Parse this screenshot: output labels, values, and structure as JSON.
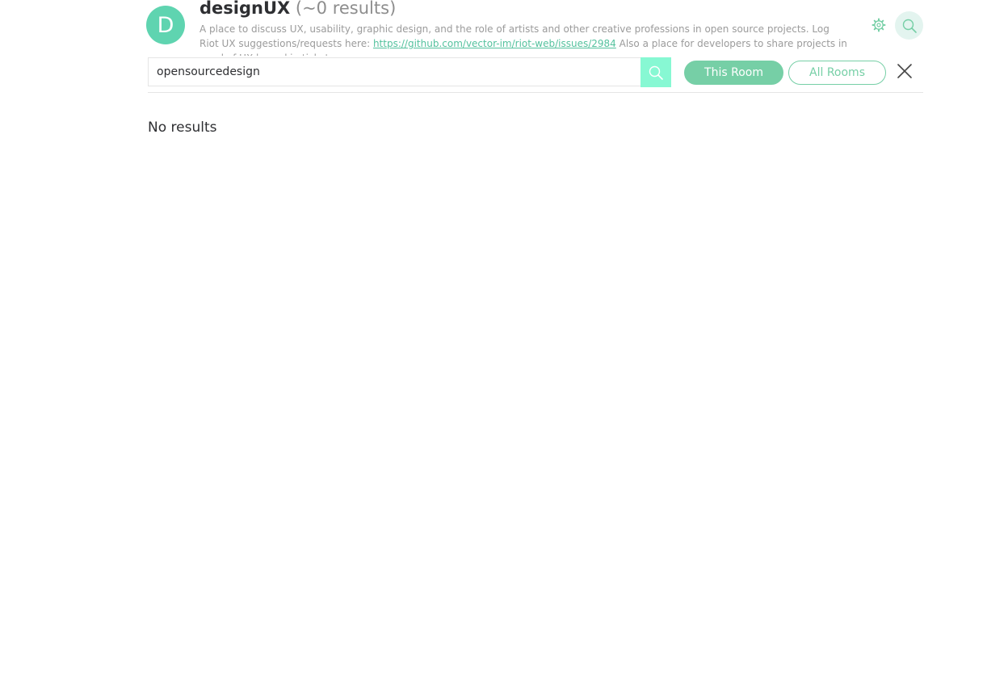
{
  "room": {
    "avatar_letter": "D",
    "name": "designUX",
    "result_count": "(~0 results)",
    "topic_before_link": "A place to discuss UX, usability, graphic design, and the role of artists and other creative professions in open source projects.  Log Riot UX suggestions/requests here: ",
    "topic_link": "https://github.com/vector-im/riot-web/issues/2984",
    "topic_after_link": " Also a place for developers to share projects in need of UX love skin tickets"
  },
  "header_icons": {
    "settings": "gear-icon",
    "search": "search-icon"
  },
  "search": {
    "query": "opensourcedesign",
    "submit_icon": "search-icon",
    "scope_this_room": "This Room",
    "scope_all_rooms": "All Rooms",
    "active_scope": "This Room",
    "cancel_icon": "close-icon"
  },
  "results": {
    "message": "No results"
  },
  "colors": {
    "accent": "#76cfa6",
    "avatar_bg": "#5fd4b0",
    "search_button_bg": "#87f8d3",
    "link": "#55c29e"
  }
}
